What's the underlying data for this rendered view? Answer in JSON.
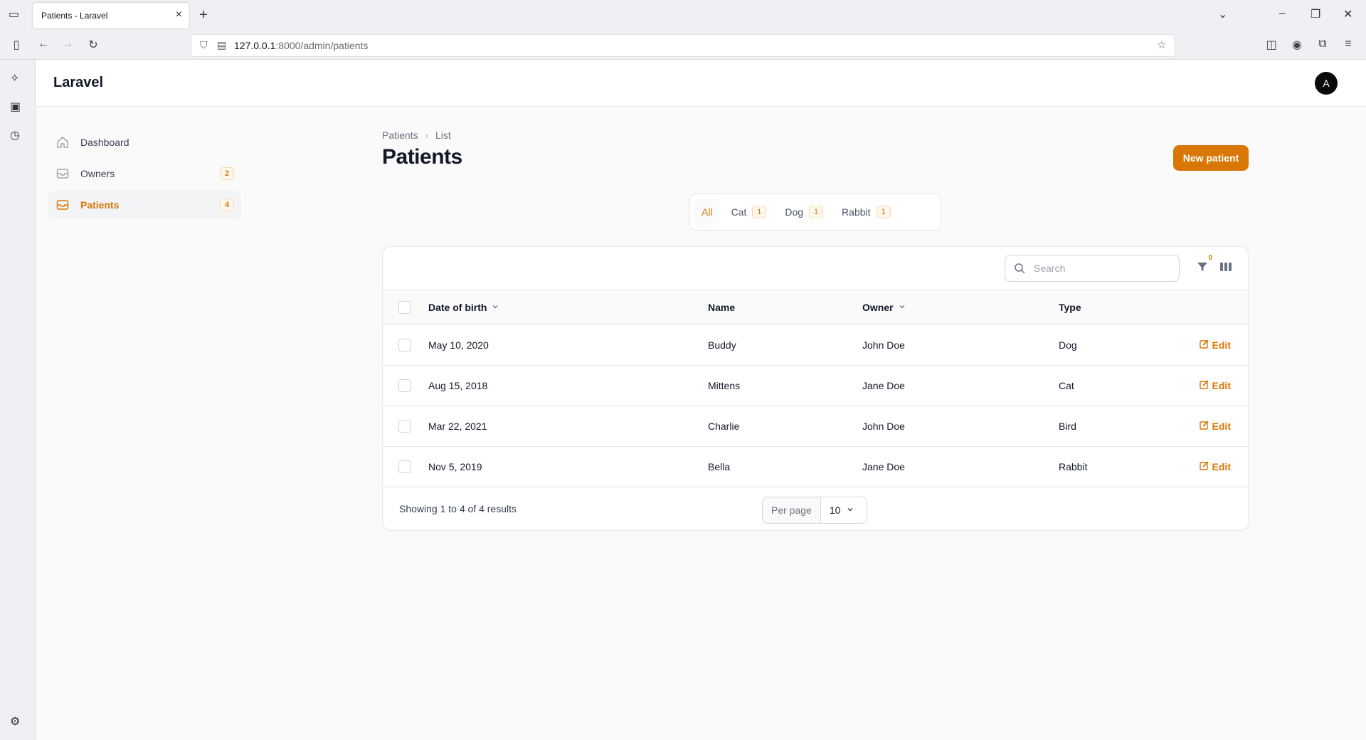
{
  "browser": {
    "tab_title": "Patients - Laravel",
    "url_host": "127.0.0.1",
    "url_path": ":8000/admin/patients"
  },
  "app": {
    "brand": "Laravel",
    "avatar_letter": "A"
  },
  "sidebar": {
    "items": [
      {
        "label": "Dashboard",
        "icon": "home-icon",
        "badge": ""
      },
      {
        "label": "Owners",
        "icon": "inbox-icon",
        "badge": "2"
      },
      {
        "label": "Patients",
        "icon": "inbox-icon",
        "badge": "4",
        "active": true
      }
    ]
  },
  "page": {
    "breadcrumb": [
      "Patients",
      "List"
    ],
    "title": "Patients",
    "new_button": "New patient"
  },
  "filter_tabs": [
    {
      "label": "All",
      "count": ""
    },
    {
      "label": "Cat",
      "count": "1"
    },
    {
      "label": "Dog",
      "count": "1"
    },
    {
      "label": "Rabbit",
      "count": "1"
    }
  ],
  "table": {
    "search_placeholder": "Search",
    "filter_count": "0",
    "columns": [
      "Date of birth",
      "Name",
      "Owner",
      "Type"
    ],
    "edit_label": "Edit",
    "rows": [
      {
        "dob": "May 10, 2020",
        "name": "Buddy",
        "owner": "John Doe",
        "type": "Dog"
      },
      {
        "dob": "Aug 15, 2018",
        "name": "Mittens",
        "owner": "Jane Doe",
        "type": "Cat"
      },
      {
        "dob": "Mar 22, 2021",
        "name": "Charlie",
        "owner": "John Doe",
        "type": "Bird"
      },
      {
        "dob": "Nov 5, 2019",
        "name": "Bella",
        "owner": "Jane Doe",
        "type": "Rabbit"
      }
    ],
    "showing_text": "Showing 1 to 4 of 4 results",
    "per_page_label": "Per page",
    "per_page_value": "10"
  },
  "colors": {
    "accent": "#d97706"
  }
}
